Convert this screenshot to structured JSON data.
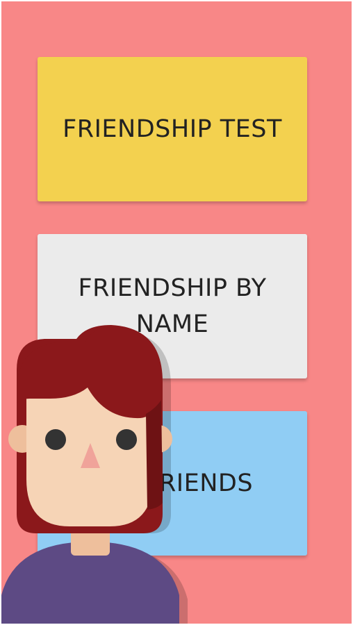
{
  "colors": {
    "background": "#f88787",
    "button_1": "#f3d14f",
    "button_2": "#ebebeb",
    "button_3": "#90cdf4",
    "hair": "#8b181b",
    "hair_shadow": "#6e1214",
    "skin": "#f6d4b6",
    "ear": "#eebf9c",
    "nose": "#f0a39a",
    "shirt": "#5d4a84",
    "eyes": "#333333"
  },
  "menu": {
    "items": [
      {
        "label": "FRIENDSHIP TEST"
      },
      {
        "label": "FRIENDSHIP BY NAME"
      },
      {
        "label": "R FRIENDS"
      }
    ]
  },
  "illustration": {
    "icon": "girl-avatar-illustration"
  }
}
